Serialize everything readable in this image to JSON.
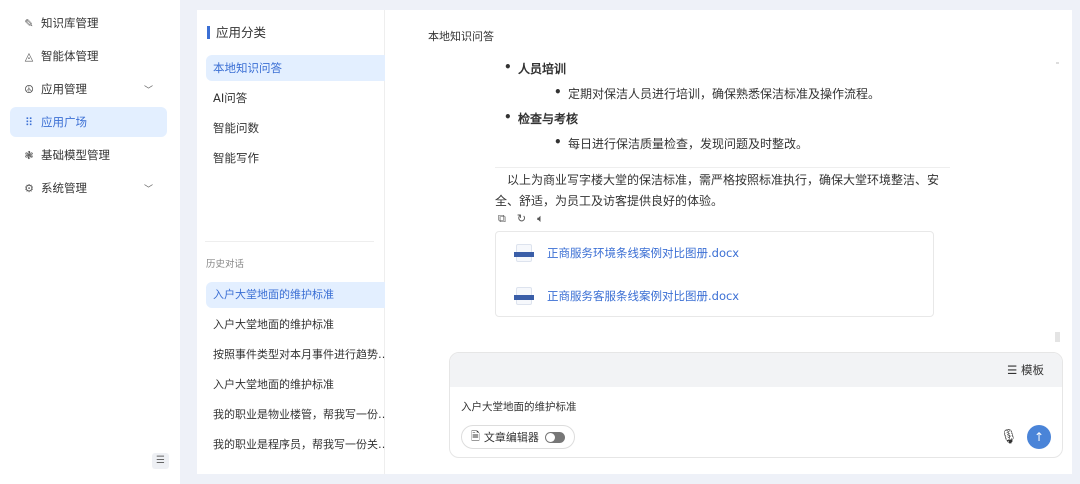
{
  "sidebar": {
    "items": [
      {
        "label": "知识库管理",
        "icon": "edit-icon"
      },
      {
        "label": "智能体管理",
        "icon": "agent-icon"
      },
      {
        "label": "应用管理",
        "icon": "app-icon",
        "expandable": true
      },
      {
        "label": "应用广场",
        "icon": "grid-icon",
        "active": true
      },
      {
        "label": "基础模型管理",
        "icon": "model-icon"
      },
      {
        "label": "系统管理",
        "icon": "gear-icon",
        "expandable": true
      }
    ]
  },
  "categories": {
    "title": "应用分类",
    "items": [
      "本地知识问答",
      "AI问答",
      "智能问数",
      "智能写作"
    ]
  },
  "history": {
    "title": "历史对话",
    "items": [
      "入户大堂地面的维护标准",
      "入户大堂地面的维护标准",
      "按照事件类型对本月事件进行趋势…",
      "入户大堂地面的维护标准",
      "我的职业是物业楼管，帮我写一份…",
      "我的职业是程序员，帮我写一份关…"
    ]
  },
  "chat": {
    "title": "本地知识问答",
    "sections": [
      {
        "heading": "人员培训",
        "item": "定期对保洁人员进行培训，确保熟悉保洁标准及操作流程。"
      },
      {
        "heading": "检查与考核",
        "item": "每日进行保洁质量检查，发现问题及时整改。"
      }
    ],
    "summary": "以上为商业写字楼大堂的保洁标准，需严格按照标准执行，确保大堂环境整洁、安全、舒适，为员工及访客提供良好的体验。",
    "files": [
      "正商服务环境条线案例对比图册.docx",
      "正商服务客服条线案例对比图册.docx"
    ],
    "input": {
      "template_label": "模板",
      "value": "入户大堂地面的维护标准",
      "editor_label": "文章编辑器"
    }
  },
  "colors": {
    "accent": "#3b6fd4",
    "send": "#4a84d8"
  }
}
